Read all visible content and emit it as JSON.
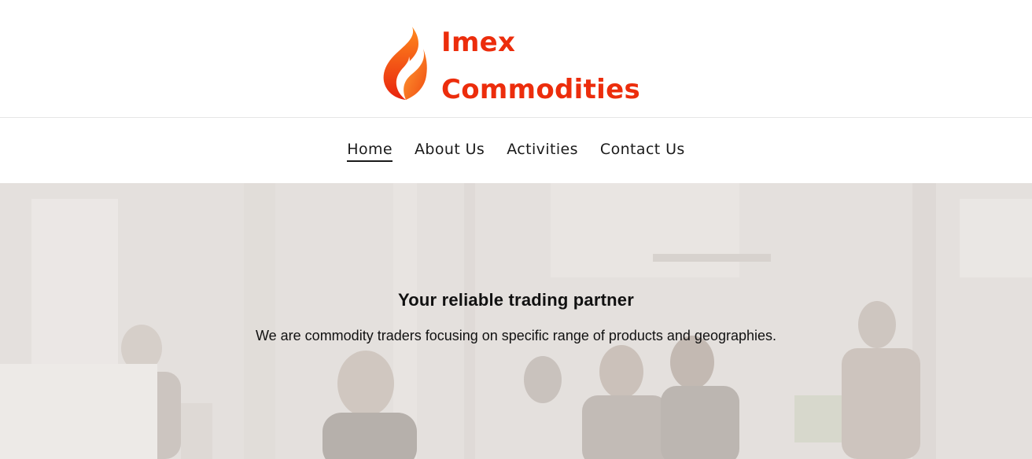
{
  "brand": {
    "name_line1": "Imex",
    "name_line2": "Commodities",
    "logo_icon": "flame-icon",
    "color": "#ec2d0c"
  },
  "nav": {
    "items": [
      {
        "label": "Home",
        "active": true
      },
      {
        "label": "About Us",
        "active": false
      },
      {
        "label": "Activities",
        "active": false
      },
      {
        "label": "Contact Us",
        "active": false
      }
    ]
  },
  "hero": {
    "title": "Your reliable trading partner",
    "subtitle": "We are commodity traders focusing on specific range of products and geographies.",
    "background_image": "office-people-photo"
  }
}
